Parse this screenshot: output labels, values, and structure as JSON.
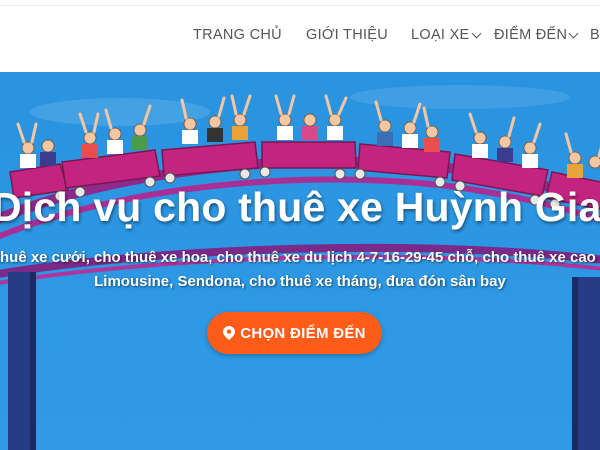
{
  "nav": {
    "items": [
      {
        "label": "TRANG CHỦ",
        "has_dropdown": false
      },
      {
        "label": "GIỚI THIỆU",
        "has_dropdown": false
      },
      {
        "label": "LOẠI XE",
        "has_dropdown": true
      },
      {
        "label": "ĐIỂM ĐẾN",
        "has_dropdown": true
      },
      {
        "label": "B",
        "has_dropdown": false
      }
    ]
  },
  "hero": {
    "title": "Dịch vụ cho thuê xe Huỳnh Gia",
    "subtitle_line1": "thuê xe cưới, cho thuê xe hoa, cho thuê xe du lịch 4-7-16-29-45 chỗ, cho thuê xe cao",
    "subtitle_line2": "Limousine, Sendona, cho thuê xe tháng, đưa đón sân bay",
    "cta_label": "CHỌN ĐIỂM ĐẾN",
    "cta_icon": "map-pin-icon"
  },
  "colors": {
    "accent": "#ff5c1a",
    "sky": "#35a2ea",
    "coaster": "#c2247f",
    "nav_text": "#555555"
  }
}
